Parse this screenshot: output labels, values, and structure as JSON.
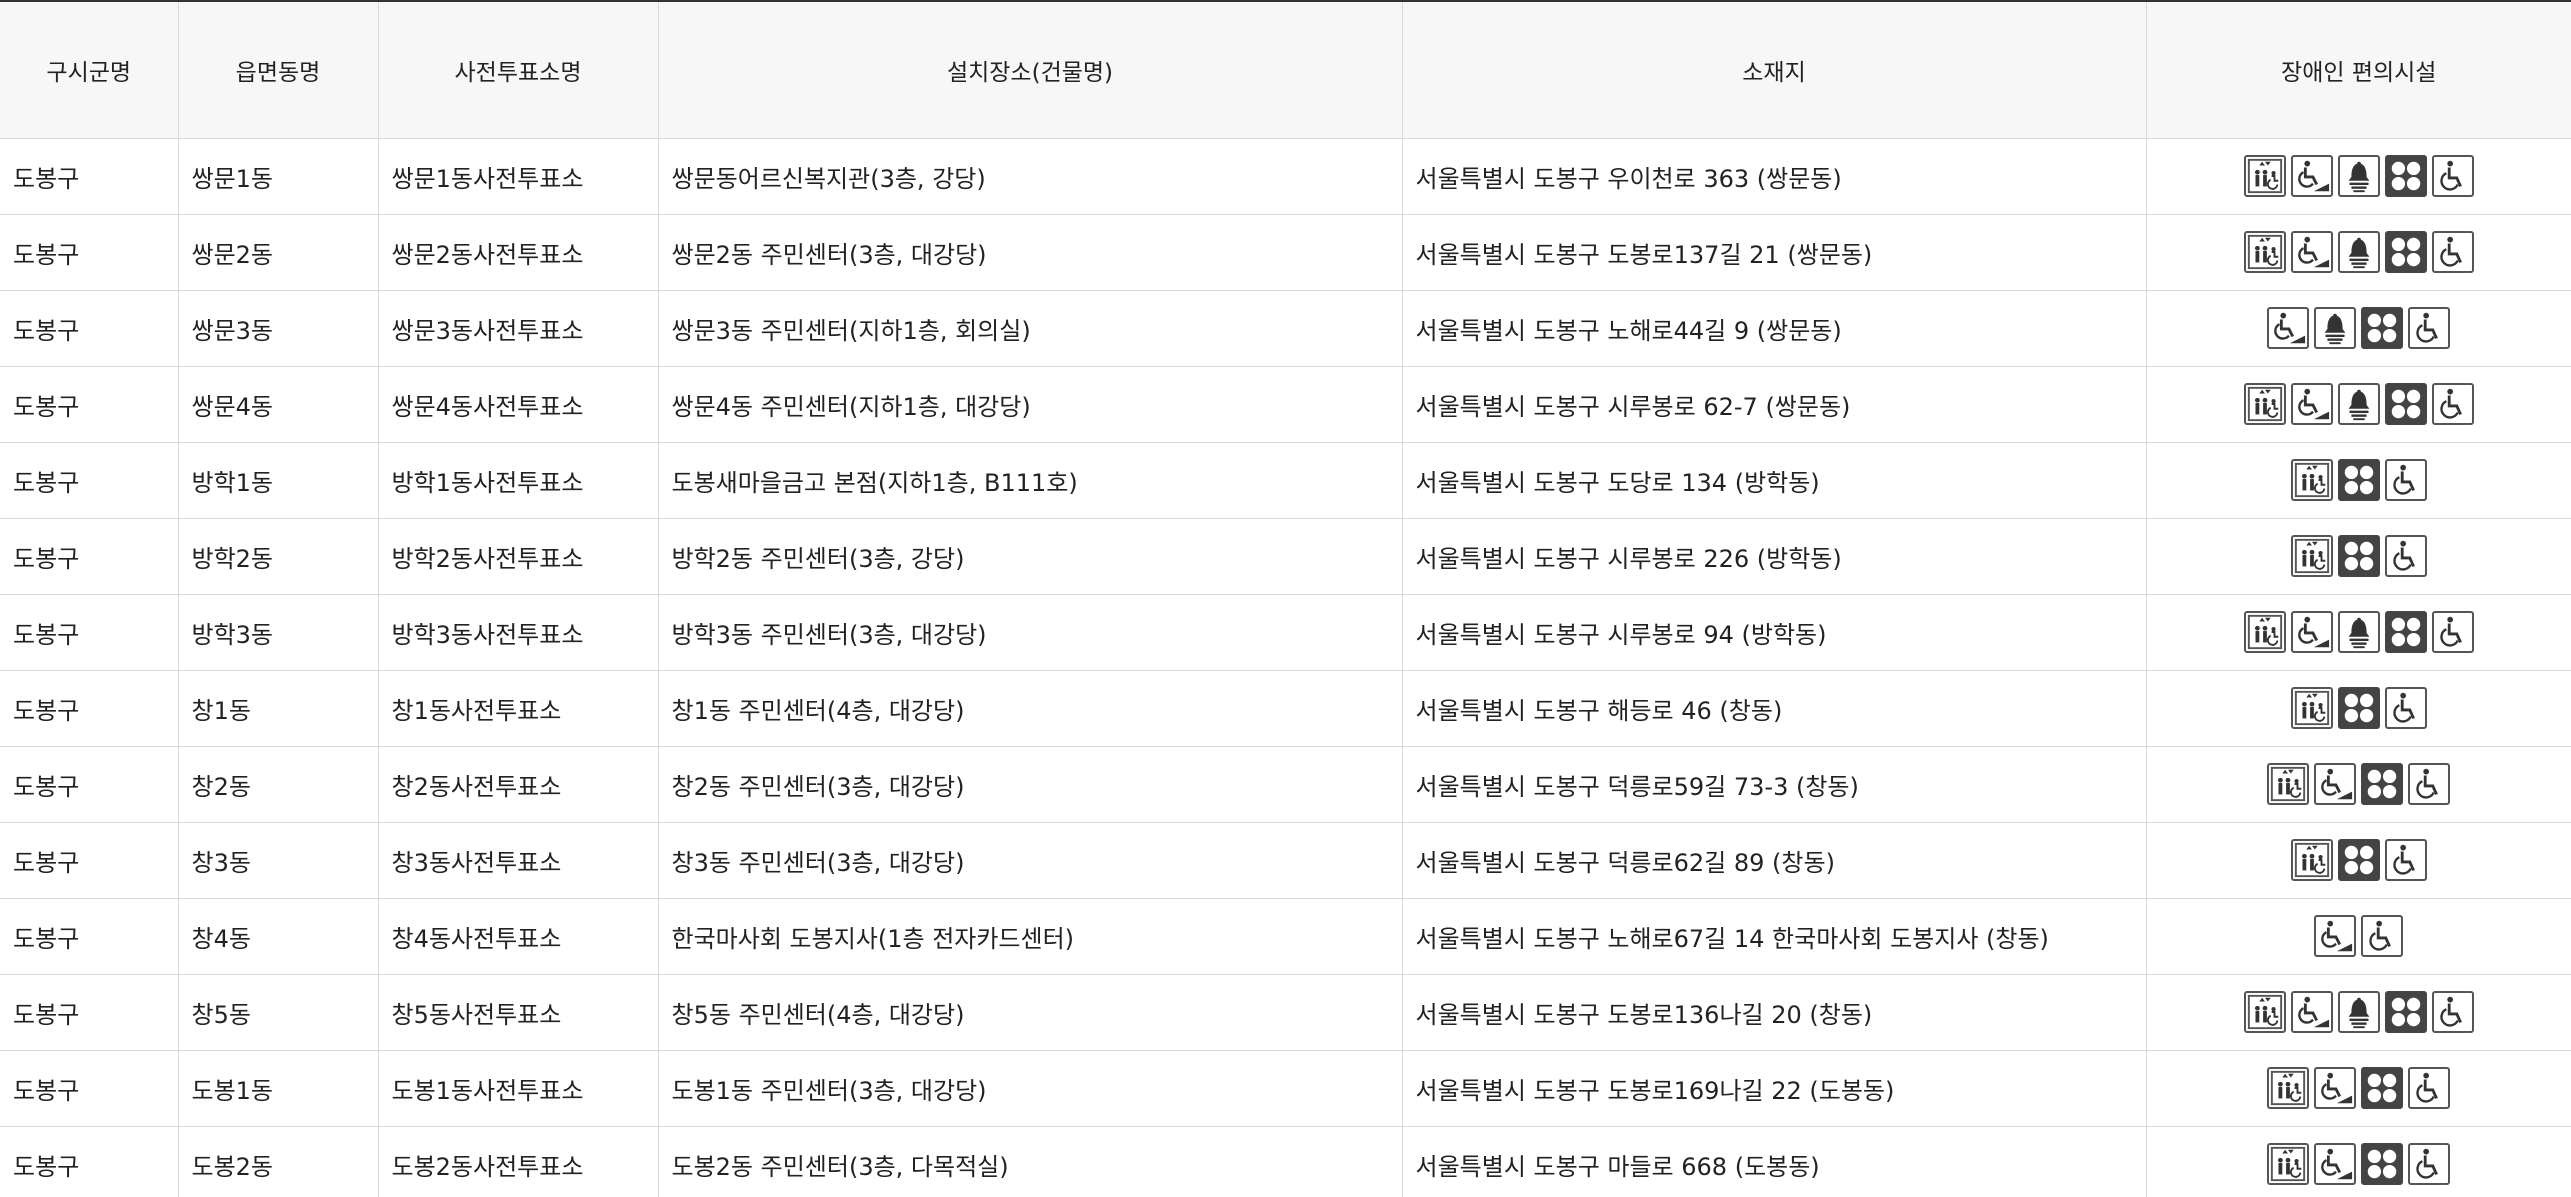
{
  "table": {
    "headers": [
      "구시군명",
      "읍면동명",
      "사전투표소명",
      "설치장소(건물명)",
      "소재지",
      "장애인 편의시설"
    ],
    "rows": [
      {
        "gu": "도봉구",
        "dong": "쌍문1동",
        "station": "쌍문1동사전투표소",
        "place": "쌍문동어르신복지관(3층, 강당)",
        "address": "서울특별시 도봉구 우이천로 363 (쌍문동)",
        "facilities": [
          "elevator-icon",
          "ramp-icon",
          "bell-icon",
          "braille-icon",
          "wheelchair-icon"
        ]
      },
      {
        "gu": "도봉구",
        "dong": "쌍문2동",
        "station": "쌍문2동사전투표소",
        "place": "쌍문2동 주민센터(3층, 대강당)",
        "address": "서울특별시 도봉구 도봉로137길 21 (쌍문동)",
        "facilities": [
          "elevator-icon",
          "ramp-icon",
          "bell-icon",
          "braille-icon",
          "wheelchair-icon"
        ]
      },
      {
        "gu": "도봉구",
        "dong": "쌍문3동",
        "station": "쌍문3동사전투표소",
        "place": "쌍문3동 주민센터(지하1층, 회의실)",
        "address": "서울특별시 도봉구 노해로44길 9 (쌍문동)",
        "facilities": [
          "ramp-icon",
          "bell-icon",
          "braille-icon",
          "wheelchair-icon"
        ]
      },
      {
        "gu": "도봉구",
        "dong": "쌍문4동",
        "station": "쌍문4동사전투표소",
        "place": "쌍문4동 주민센터(지하1층, 대강당)",
        "address": "서울특별시 도봉구 시루봉로 62-7 (쌍문동)",
        "facilities": [
          "elevator-icon",
          "ramp-icon",
          "bell-icon",
          "braille-icon",
          "wheelchair-icon"
        ]
      },
      {
        "gu": "도봉구",
        "dong": "방학1동",
        "station": "방학1동사전투표소",
        "place": "도봉새마을금고 본점(지하1층, B111호)",
        "address": "서울특별시 도봉구 도당로 134 (방학동)",
        "facilities": [
          "elevator-icon",
          "braille-icon",
          "wheelchair-icon"
        ]
      },
      {
        "gu": "도봉구",
        "dong": "방학2동",
        "station": "방학2동사전투표소",
        "place": "방학2동 주민센터(3층, 강당)",
        "address": "서울특별시 도봉구 시루봉로 226 (방학동)",
        "facilities": [
          "elevator-icon",
          "braille-icon",
          "wheelchair-icon"
        ]
      },
      {
        "gu": "도봉구",
        "dong": "방학3동",
        "station": "방학3동사전투표소",
        "place": "방학3동 주민센터(3층, 대강당)",
        "address": "서울특별시 도봉구 시루봉로 94 (방학동)",
        "facilities": [
          "elevator-icon",
          "ramp-icon",
          "bell-icon",
          "braille-icon",
          "wheelchair-icon"
        ]
      },
      {
        "gu": "도봉구",
        "dong": "창1동",
        "station": "창1동사전투표소",
        "place": "창1동 주민센터(4층, 대강당)",
        "address": "서울특별시 도봉구 해등로 46 (창동)",
        "facilities": [
          "elevator-icon",
          "braille-icon",
          "wheelchair-icon"
        ]
      },
      {
        "gu": "도봉구",
        "dong": "창2동",
        "station": "창2동사전투표소",
        "place": "창2동 주민센터(3층, 대강당)",
        "address": "서울특별시 도봉구 덕릉로59길 73-3 (창동)",
        "facilities": [
          "elevator-icon",
          "ramp-icon",
          "braille-icon",
          "wheelchair-icon"
        ]
      },
      {
        "gu": "도봉구",
        "dong": "창3동",
        "station": "창3동사전투표소",
        "place": "창3동 주민센터(3층, 대강당)",
        "address": "서울특별시 도봉구 덕릉로62길 89 (창동)",
        "facilities": [
          "elevator-icon",
          "braille-icon",
          "wheelchair-icon"
        ]
      },
      {
        "gu": "도봉구",
        "dong": "창4동",
        "station": "창4동사전투표소",
        "place": "한국마사회 도봉지사(1층 전자카드센터)",
        "address": "서울특별시 도봉구 노해로67길 14 한국마사회 도봉지사 (창동)",
        "facilities": [
          "ramp-icon",
          "wheelchair-icon"
        ]
      },
      {
        "gu": "도봉구",
        "dong": "창5동",
        "station": "창5동사전투표소",
        "place": "창5동 주민센터(4층, 대강당)",
        "address": "서울특별시 도봉구 도봉로136나길 20 (창동)",
        "facilities": [
          "elevator-icon",
          "ramp-icon",
          "bell-icon",
          "braille-icon",
          "wheelchair-icon"
        ]
      },
      {
        "gu": "도봉구",
        "dong": "도봉1동",
        "station": "도봉1동사전투표소",
        "place": "도봉1동 주민센터(3층, 대강당)",
        "address": "서울특별시 도봉구 도봉로169나길 22 (도봉동)",
        "facilities": [
          "elevator-icon",
          "ramp-icon",
          "braille-icon",
          "wheelchair-icon"
        ]
      },
      {
        "gu": "도봉구",
        "dong": "도봉2동",
        "station": "도봉2동사전투표소",
        "place": "도봉2동 주민센터(3층, 다목적실)",
        "address": "서울특별시 도봉구 마들로 668 (도봉동)",
        "facilities": [
          "elevator-icon",
          "ramp-icon",
          "braille-icon",
          "wheelchair-icon"
        ]
      }
    ]
  }
}
